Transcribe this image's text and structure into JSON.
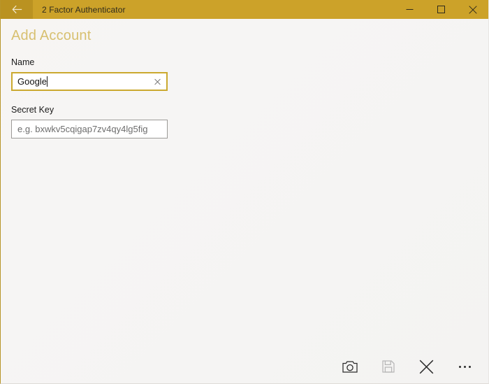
{
  "window": {
    "title": "2 Factor Authenticator",
    "back_icon": "back-arrow-icon",
    "accent_color": "#cca229",
    "back_button_color": "#ba9221",
    "controls": [
      {
        "name": "minimize",
        "label": "Minimize",
        "icon": "minimize-icon"
      },
      {
        "name": "maximize",
        "label": "Maximize",
        "icon": "maximize-icon"
      },
      {
        "name": "close",
        "label": "Close",
        "icon": "close-icon"
      }
    ]
  },
  "page": {
    "title": "Add Account",
    "title_color": "#d8c070",
    "fields": [
      {
        "label": "Name",
        "value": "Google",
        "placeholder": "",
        "focused": true,
        "clear_icon": "clear-x-icon"
      },
      {
        "label": "Secret Key",
        "value": "",
        "placeholder": "e.g. bxwkv5cqigap7zv4qy4lg5fig",
        "focused": false,
        "clear_icon": ""
      }
    ]
  },
  "commandbar": {
    "buttons": [
      {
        "name": "scan-qr-code",
        "label": "Scan",
        "icon": "camera-icon",
        "enabled": true
      },
      {
        "name": "save",
        "label": "Save",
        "icon": "save-floppy-icon",
        "enabled": false
      },
      {
        "name": "cancel",
        "label": "Cancel",
        "icon": "close-x-icon",
        "enabled": true
      },
      {
        "name": "more-options",
        "label": "See more",
        "icon": "ellipsis-icon",
        "enabled": true
      }
    ]
  }
}
